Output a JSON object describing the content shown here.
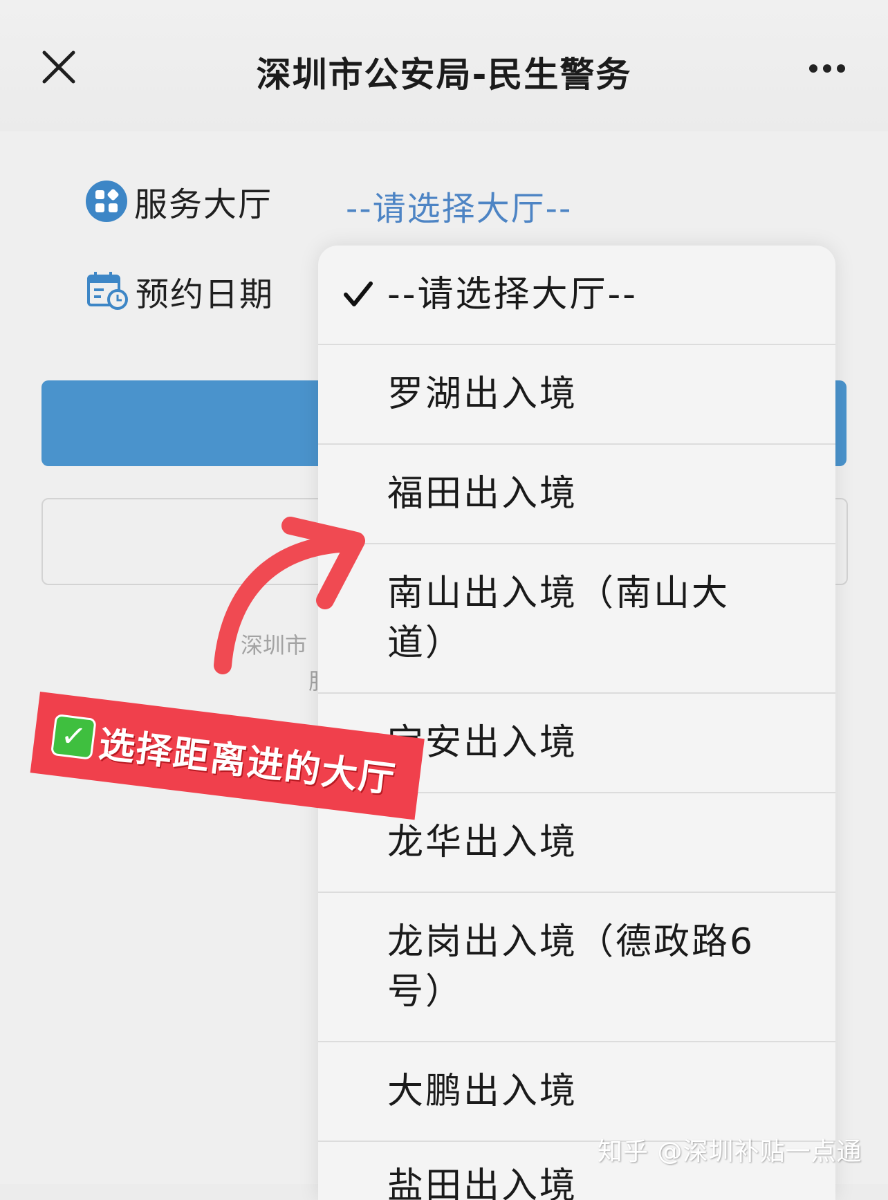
{
  "header": {
    "title": "深圳市公安局-民生警务"
  },
  "form": {
    "hall_label": "服务大厅",
    "hall_value": "--请选择大厅--",
    "date_label": "预约日期",
    "footer_line1": "深圳市",
    "footer_line2": "服"
  },
  "dropdown": {
    "options": [
      {
        "label": "--请选择大厅--",
        "selected": true
      },
      {
        "label": "罗湖出入境",
        "selected": false
      },
      {
        "label": "福田出入境",
        "selected": false
      },
      {
        "label": "南山出入境（南山大道）",
        "selected": false
      },
      {
        "label": "宝安出入境",
        "selected": false
      },
      {
        "label": "龙华出入境",
        "selected": false
      },
      {
        "label": "龙岗出入境（德政路6号）",
        "selected": false
      },
      {
        "label": "大鹏出入境",
        "selected": false
      },
      {
        "label": "盐田出入境",
        "selected": false
      }
    ]
  },
  "annotation": {
    "banner_text": "选择距离进的大厅"
  },
  "watermark": "知乎 @深圳补贴一点通",
  "colors": {
    "accent_blue": "#4a93cc",
    "link_blue": "#4d84c4",
    "annotation_red": "#f0404c",
    "check_green": "#3fbf3f"
  },
  "icons": {
    "close": "close-icon",
    "more": "more-icon",
    "hall": "grid-apps-icon",
    "date": "calendar-clock-icon",
    "selected": "check-icon",
    "annotation_arrow": "curved-arrow-icon"
  }
}
